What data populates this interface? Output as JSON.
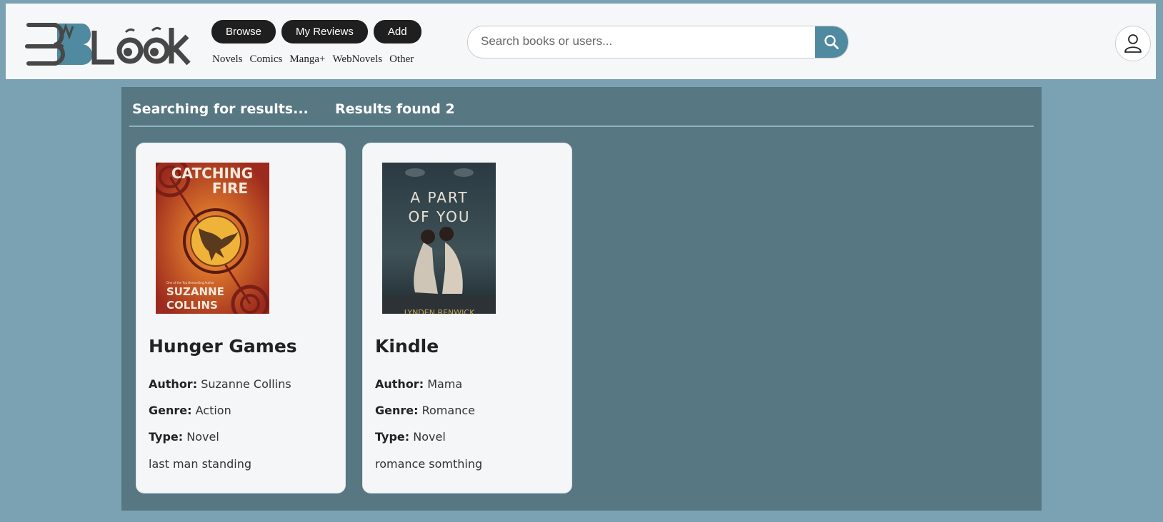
{
  "header": {
    "logo": {
      "text": "BLook",
      "icon": "logo-icon"
    },
    "nav": {
      "browse": "Browse",
      "my_reviews": "My Reviews",
      "add": "Add"
    },
    "categories": [
      "Novels",
      "Comics",
      "Manga+",
      "WebNovels",
      "Other"
    ],
    "search": {
      "placeholder": "Search books or users...",
      "icon": "search-icon"
    },
    "profile_icon": "user-icon"
  },
  "results": {
    "status": "Searching for results...",
    "count_text": "Results found 2",
    "books": [
      {
        "title": "Hunger Games",
        "author_label": "Author:",
        "author": "Suzanne Collins",
        "genre_label": "Genre:",
        "genre": "Action",
        "type_label": "Type:",
        "type": "Novel",
        "description": "last man standing",
        "cover": {
          "title_line1": "CATCHING",
          "title_line2": "FIRE",
          "author_line1": "SUZANNE",
          "author_line2": "COLLINS",
          "tagline": "One of the Top Bestselling Author"
        }
      },
      {
        "title": "Kindle",
        "author_label": "Author:",
        "author": "Mama",
        "genre_label": "Genre:",
        "genre": "Romance",
        "type_label": "Type:",
        "type": "Novel",
        "description": "romance somthing",
        "cover": {
          "title_line1": "A PART",
          "title_line2": "OF YOU",
          "author_line1": "LYNDEN RENWICK"
        }
      }
    ]
  },
  "colors": {
    "page_bg": "#7aa2b2",
    "panel_bg": "#577783",
    "accent": "#4f8aa0",
    "button_bg": "#1f1f1f"
  }
}
